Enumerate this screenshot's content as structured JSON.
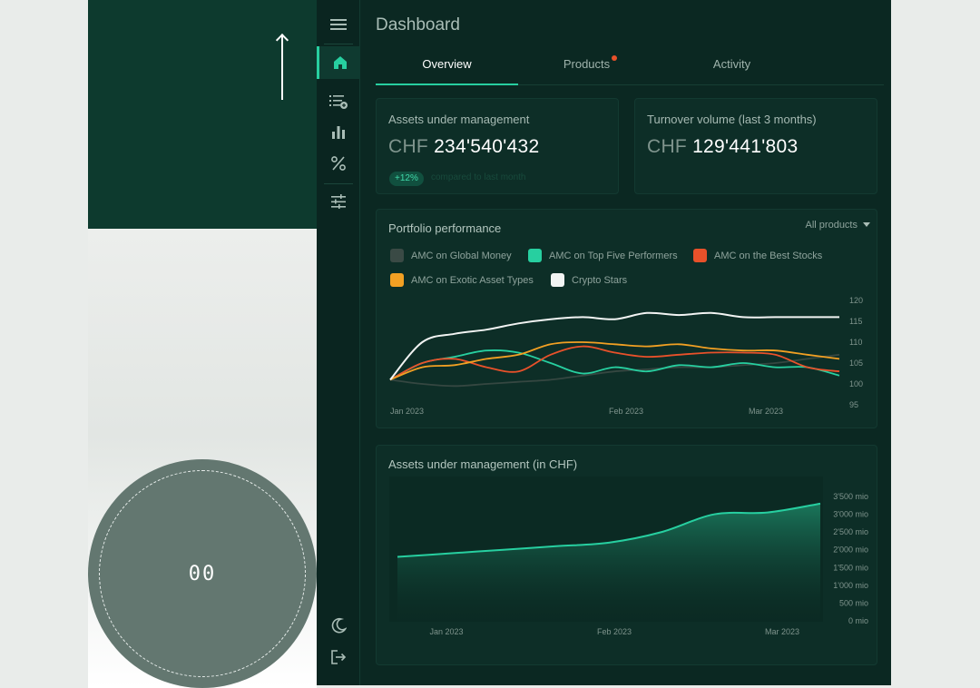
{
  "promo": {
    "badge_text": "00"
  },
  "app": {
    "title": "Dashboard",
    "tabs": [
      {
        "label": "Overview",
        "active": true
      },
      {
        "label": "Products",
        "notification": true
      },
      {
        "label": "Activity"
      }
    ],
    "rail_icons": [
      "menu-icon",
      "home-icon",
      "list-add-icon",
      "bar-chart-icon",
      "percent-icon",
      "sliders-icon",
      "moon-icon",
      "logout-icon"
    ],
    "kpis": [
      {
        "label": "Assets under management",
        "currency": "CHF",
        "value": "234'540'432",
        "change": "+12%",
        "change_note": "compared to last month"
      },
      {
        "label": "Turnover volume (last 3 months)",
        "currency": "CHF",
        "value": "129'441'803"
      }
    ],
    "portfolio": {
      "title": "Portfolio performance",
      "filter": "All products"
    },
    "aum_chart": {
      "title": "Assets under management (in CHF)"
    }
  },
  "colors": {
    "accent": "#27cfa0",
    "background": "#0b2822",
    "notification": "#e8512a"
  },
  "chart_data": [
    {
      "type": "line",
      "title": "Portfolio performance",
      "x": [
        "Jan 2023",
        "",
        "",
        "",
        "",
        "",
        "Feb 2023",
        "",
        "",
        "",
        "",
        "",
        "Mar 2023",
        "",
        ""
      ],
      "xtick_labels": [
        "Jan 2023",
        "Feb 2023",
        "Mar 2023"
      ],
      "ylim": [
        95,
        120
      ],
      "yticks": [
        95,
        100,
        105,
        110,
        115,
        120
      ],
      "y_axis_side": "right",
      "legend_position": "top",
      "series": [
        {
          "name": "AMC on Global Money",
          "color": "#3a4a45",
          "values": [
            101,
            100,
            99.5,
            100,
            100.5,
            101,
            102,
            103,
            103.5,
            104,
            104,
            104.5,
            105,
            106,
            107
          ]
        },
        {
          "name": "AMC on Top Five Performers",
          "color": "#27cfa0",
          "values": [
            101,
            105,
            106.5,
            108,
            107.5,
            105,
            102.5,
            104,
            103,
            104.5,
            104,
            105,
            104,
            104,
            102
          ]
        },
        {
          "name": "AMC on the Best Stocks",
          "color": "#e8512a",
          "values": [
            101,
            105,
            106,
            104,
            103,
            107,
            109,
            107.5,
            106.5,
            107,
            107.5,
            107.5,
            107,
            104,
            103
          ]
        },
        {
          "name": "AMC on Exotic Asset Types",
          "color": "#f2a023",
          "values": [
            101,
            104,
            104.5,
            106,
            107,
            109.5,
            110,
            109.5,
            109,
            109.5,
            108.5,
            108,
            108,
            107,
            106
          ]
        },
        {
          "name": "Crypto Stars",
          "color": "#f2f4f3",
          "values": [
            101,
            110,
            112,
            113,
            114.5,
            115.5,
            116,
            115.5,
            117,
            116.5,
            117,
            116,
            116,
            116,
            116
          ]
        }
      ]
    },
    {
      "type": "area",
      "title": "Assets under management (in CHF)",
      "x": [
        "Jan 2023",
        "",
        "",
        "Feb 2023",
        "",
        "",
        "",
        "Mar 2023",
        ""
      ],
      "xtick_labels": [
        "Jan 2023",
        "Feb 2023",
        "Mar 2023"
      ],
      "ylim": [
        0,
        3500
      ],
      "yticks": [
        0,
        500,
        1000,
        1500,
        2000,
        2500,
        3000,
        3500
      ],
      "ytick_labels": [
        "0 mio",
        "500 mio",
        "1'000 mio",
        "1'500 mio",
        "2'000 mio",
        "2'500 mio",
        "3'000 mio",
        "3'500 mio"
      ],
      "y_axis_side": "right",
      "series": [
        {
          "color": "#27cfa0",
          "values": [
            1800,
            1900,
            2000,
            2100,
            2200,
            2500,
            3000,
            3050,
            3300
          ]
        }
      ]
    }
  ]
}
